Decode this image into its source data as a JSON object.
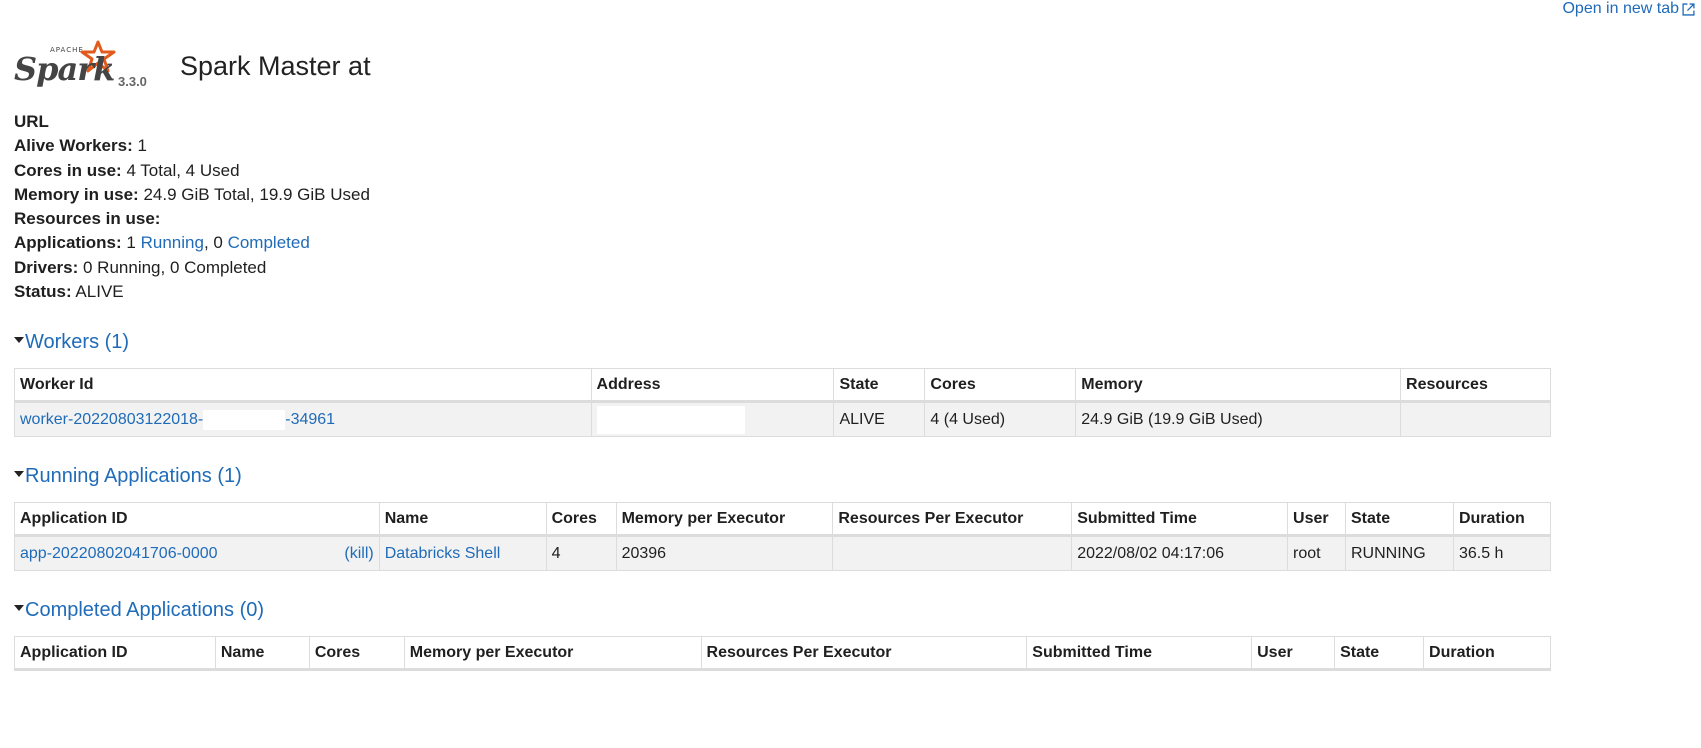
{
  "open_tab_label": "Open in new tab",
  "logo": {
    "apache": "APACHE",
    "spark": "Spark",
    "version": "3.3.0"
  },
  "page_title": "Spark Master at",
  "summary": {
    "url_label": "URL",
    "workers_label": "Alive Workers:",
    "workers_value": "1",
    "cores_label": "Cores in use:",
    "cores_value": "4 Total, 4 Used",
    "memory_label": "Memory in use:",
    "memory_value": "24.9 GiB Total, 19.9 GiB Used",
    "resources_label": "Resources in use:",
    "apps_label": "Applications:",
    "apps_running_count": "1",
    "apps_running_link": "Running",
    "apps_sep": ", 0",
    "apps_completed_link": "Completed",
    "drivers_label": "Drivers:",
    "drivers_value": "0 Running, 0 Completed",
    "status_label": "Status:",
    "status_value": "ALIVE"
  },
  "workers": {
    "heading": "Workers (1)",
    "columns": [
      "Worker Id",
      "Address",
      "State",
      "Cores",
      "Memory",
      "Resources"
    ],
    "rows": [
      {
        "id_prefix": "worker-20220803122018-",
        "id_suffix": "-34961",
        "address": "",
        "state": "ALIVE",
        "cores": "4 (4 Used)",
        "memory": "24.9 GiB (19.9 GiB Used)",
        "resources": ""
      }
    ]
  },
  "running": {
    "heading": "Running Applications (1)",
    "columns": [
      "Application ID",
      "Name",
      "Cores",
      "Memory per Executor",
      "Resources Per Executor",
      "Submitted Time",
      "User",
      "State",
      "Duration"
    ],
    "rows": [
      {
        "app_id": "app-20220802041706-0000",
        "kill": "(kill)",
        "name": "Databricks Shell",
        "cores": "4",
        "memory": "20396",
        "resources": "",
        "submitted": "2022/08/02 04:17:06",
        "user": "root",
        "state": "RUNNING",
        "duration": "36.5 h"
      }
    ]
  },
  "completed": {
    "heading": "Completed Applications (0)",
    "columns": [
      "Application ID",
      "Name",
      "Cores",
      "Memory per Executor",
      "Resources Per Executor",
      "Submitted Time",
      "User",
      "State",
      "Duration"
    ]
  }
}
